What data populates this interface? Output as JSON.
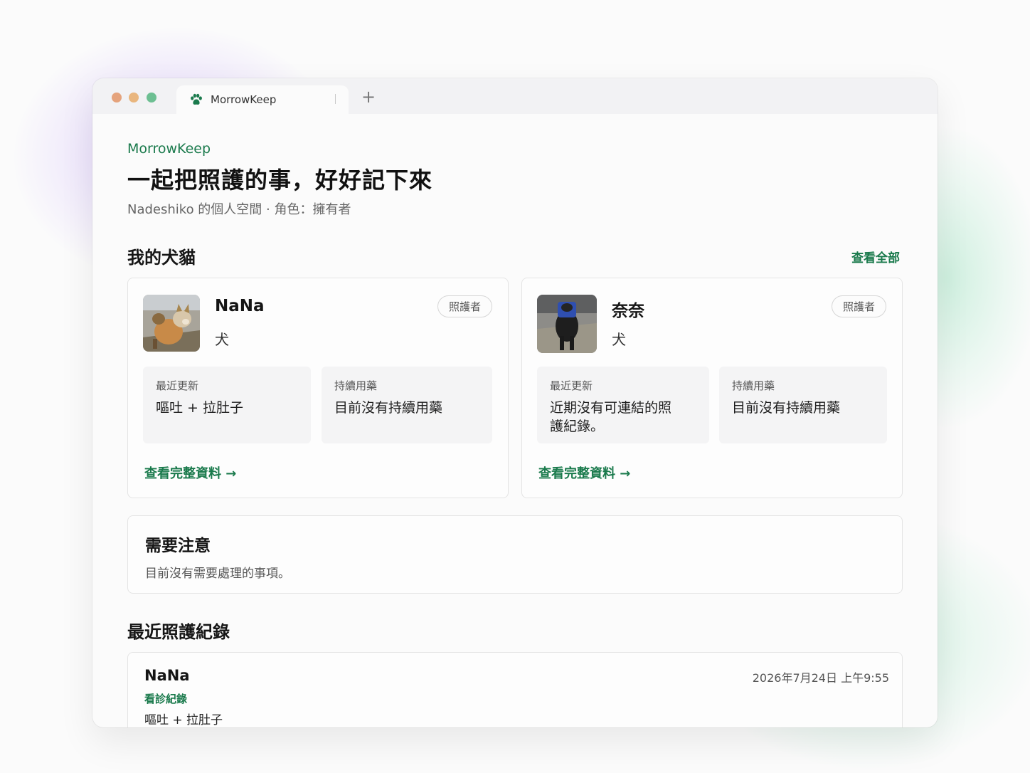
{
  "browser": {
    "tab_title": "MorrowKeep",
    "new_tab_symbol": "+"
  },
  "header": {
    "brand": "MorrowKeep",
    "headline": "一起把照護的事，好好記下來",
    "subline": "Nadeshiko 的個人空間 · 角色：擁有者"
  },
  "pets_section": {
    "title": "我的犬貓",
    "view_all": "查看全部",
    "pets": [
      {
        "name": "NaNa",
        "species": "犬",
        "role": "照護者",
        "latest_label": "最近更新",
        "latest_value": "嘔吐 + 拉肚子",
        "med_label": "持續用藥",
        "med_value": "目前沒有持續用藥",
        "link": "查看完整資料 →"
      },
      {
        "name": "奈奈",
        "species": "犬",
        "role": "照護者",
        "latest_label": "最近更新",
        "latest_value": "近期沒有可連結的照護紀錄。",
        "med_label": "持續用藥",
        "med_value": "目前沒有持續用藥",
        "link": "查看完整資料 →"
      }
    ]
  },
  "attention": {
    "title": "需要注意",
    "text": "目前沒有需要處理的事項。"
  },
  "records_section": {
    "title": "最近照護紀錄",
    "records": [
      {
        "pet": "NaNa",
        "date": "2026年7月24日 上午9:55",
        "type": "看診紀錄",
        "desc": "嘔吐 + 拉肚子"
      }
    ]
  },
  "colors": {
    "accent": "#1a7a4c",
    "traffic_red": "#e5a37c",
    "traffic_yellow": "#e9b67e",
    "traffic_green": "#6dbf92"
  },
  "icons": {
    "tab": "paw-icon"
  }
}
